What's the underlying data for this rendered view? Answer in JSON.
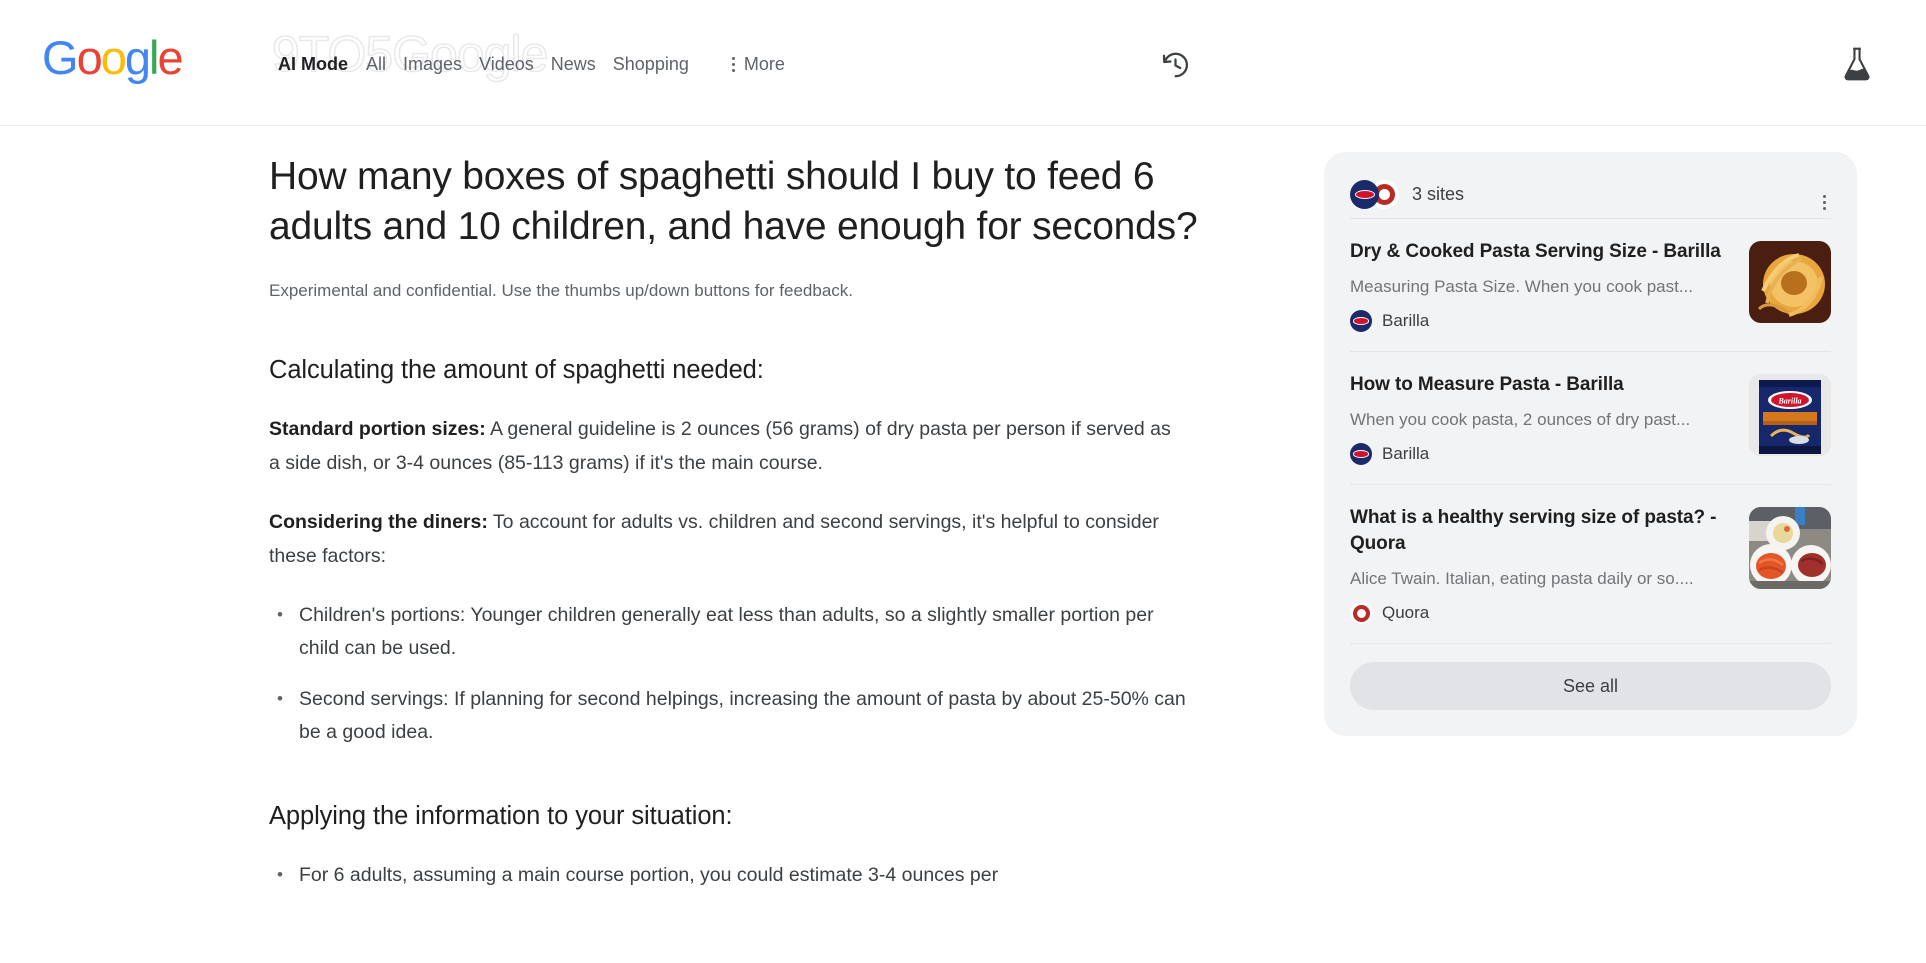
{
  "header": {
    "logo": {
      "letters": [
        "G",
        "o",
        "o",
        "g",
        "l",
        "e"
      ]
    },
    "watermark": "9TO5Google",
    "nav": [
      {
        "label": "AI Mode",
        "active": true
      },
      {
        "label": "All",
        "active": false
      },
      {
        "label": "Images",
        "active": false
      },
      {
        "label": "Videos",
        "active": false
      },
      {
        "label": "News",
        "active": false
      },
      {
        "label": "Shopping",
        "active": false
      }
    ],
    "more_label": "More",
    "history_icon": "history-icon",
    "labs_icon": "lab-flask-icon"
  },
  "main": {
    "title": "How many boxes of spaghetti should I buy to feed 6 adults and 10 children, and have enough for seconds?",
    "disclaimer": "Experimental and confidential. Use the thumbs up/down buttons for feedback.",
    "section1_heading": "Calculating the amount of spaghetti needed:",
    "para1_bold": "Standard portion sizes:",
    "para1_text": " A general guideline is 2 ounces (56 grams) of dry pasta per person if served as a side dish, or 3-4 ounces (85-113 grams) if it's the main course.",
    "para2_bold": "Considering the diners:",
    "para2_text": " To account for adults vs. children and second servings, it's helpful to consider these factors:",
    "bullets": [
      "Children's portions: Younger children generally eat less than adults, so a slightly smaller portion per child can be used.",
      "Second servings: If planning for second helpings, increasing the amount of pasta by about 25-50% can be a good idea."
    ],
    "section2_heading": "Applying the information to your situation:",
    "bullets2": [
      "For 6 adults, assuming a main course portion, you could estimate 3-4 ounces per"
    ]
  },
  "sources": {
    "count_label": "3 sites",
    "menu_icon": "more-options-icon",
    "see_all_label": "See all",
    "items": [
      {
        "title": "Dry & Cooked Pasta Serving Size - Barilla",
        "snippet": "Measuring Pasta Size. When you cook past...",
        "source": "Barilla",
        "favicon": "barilla-favicon",
        "thumbnail": "pasta-nest-thumbnail"
      },
      {
        "title": "How to Measure Pasta - Barilla",
        "snippet": "When you cook pasta, 2 ounces of dry past...",
        "source": "Barilla",
        "favicon": "barilla-favicon",
        "thumbnail": "barilla-box-thumbnail"
      },
      {
        "title": "What is a healthy serving size of pasta? - Quora",
        "snippet": "Alice Twain. Italian, eating pasta daily or so....",
        "source": "Quora",
        "favicon": "quora-favicon",
        "thumbnail": "pasta-plates-thumbnail"
      }
    ]
  },
  "colors": {
    "google_blue": "#4285F4",
    "google_red": "#EA4335",
    "google_yellow": "#FBBC05",
    "google_green": "#34A853",
    "card_bg": "#f2f3f4",
    "see_all_bg": "#e1e3e6",
    "text_primary": "#1f1f1f",
    "text_secondary": "#5f6368"
  }
}
